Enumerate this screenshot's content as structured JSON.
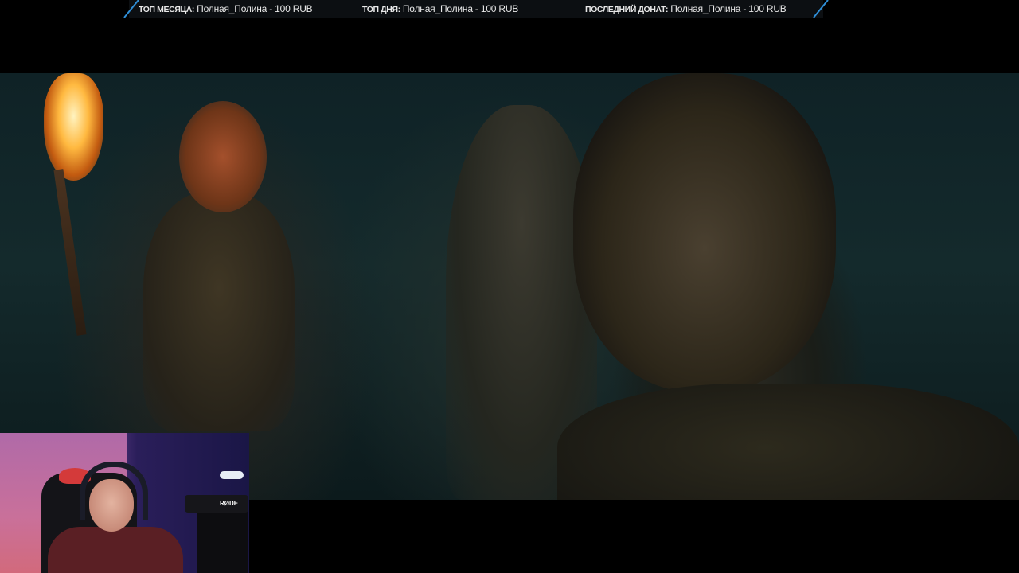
{
  "ticker": {
    "items": [
      {
        "label": "ТОП МЕСЯЦА:",
        "value": "Полная_Полина - 100 RUB"
      },
      {
        "label": "ТОП ДНЯ:",
        "value": "Полная_Полина - 100 RUB"
      },
      {
        "label": "ПОСЛЕДНИЙ ДОНАТ:",
        "value": "Полная_Полина - 100 RUB"
      }
    ],
    "accent_color": "#2f8fd8"
  },
  "webcam": {
    "mic_brand": "RØDE"
  }
}
